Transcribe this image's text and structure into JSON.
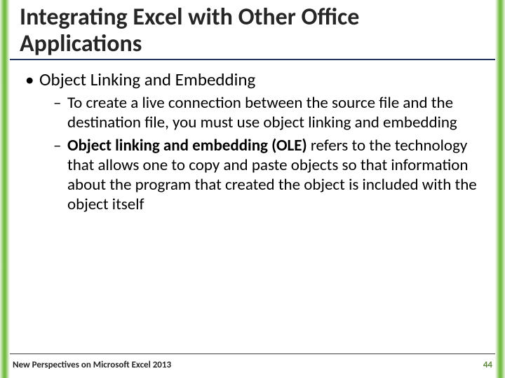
{
  "title": "Integrating Excel with Other Office Applications",
  "bullets": {
    "lvl1_0": "Object Linking and Embedding",
    "lvl2_0_pre": "To create a live connection between the source file and the destination file, you must use object linking and embedding",
    "lvl2_1_bold": "Object linking and embedding (OLE)",
    "lvl2_1_rest": " refers to the technology that allows one to copy and paste objects so that information about the program that created the object is included with the object itself"
  },
  "footer": {
    "left": "New Perspectives on Microsoft Excel 2013",
    "page": "44"
  },
  "colors": {
    "accent_underline": "#21365f",
    "edge_green": "#74bb42",
    "page_number": "#5f8b3c"
  }
}
